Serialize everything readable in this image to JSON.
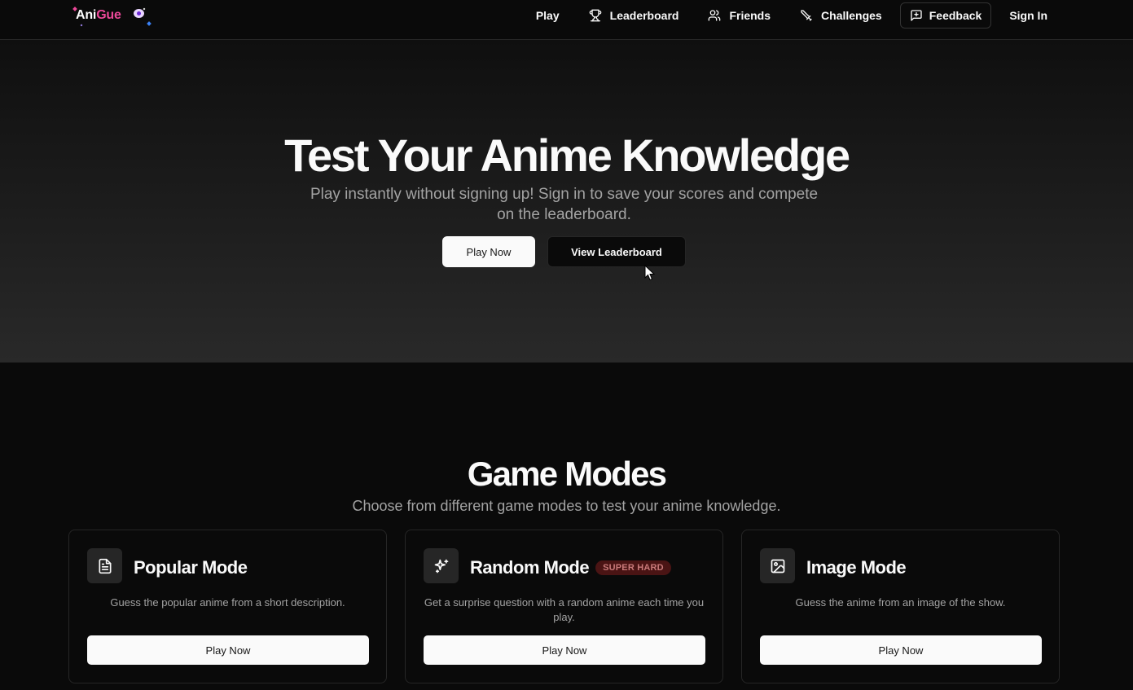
{
  "brand": {
    "part1": "Ani",
    "part2": "Gue",
    "accent_color": "#ec4899"
  },
  "nav": {
    "items": [
      {
        "label": "Play",
        "icon": ""
      },
      {
        "label": "Leaderboard",
        "icon": "trophy-icon"
      },
      {
        "label": "Friends",
        "icon": "users-icon"
      },
      {
        "label": "Challenges",
        "icon": "swords-icon"
      },
      {
        "label": "Feedback",
        "icon": "message-plus-icon"
      },
      {
        "label": "Sign In",
        "icon": ""
      }
    ]
  },
  "hero": {
    "title": "Test Your Anime Knowledge",
    "subtitle": "Play instantly without signing up! Sign in to save your scores and compete on the leaderboard.",
    "primary_button": "Play Now",
    "secondary_button": "View Leaderboard"
  },
  "modes": {
    "title": "Game Modes",
    "subtitle": "Choose from different game modes to test your anime knowledge.",
    "cards": [
      {
        "title": "Popular Mode",
        "badge": "",
        "icon": "document-icon",
        "description": "Guess the popular anime from a short description.",
        "button": "Play Now"
      },
      {
        "title": "Random Mode",
        "badge": "SUPER HARD",
        "icon": "sparkles-icon",
        "description": "Get a surprise question with a random anime each time you play.",
        "button": "Play Now"
      },
      {
        "title": "Image Mode",
        "badge": "",
        "icon": "image-icon",
        "description": "Guess the anime from an image of the show.",
        "button": "Play Now"
      }
    ]
  }
}
